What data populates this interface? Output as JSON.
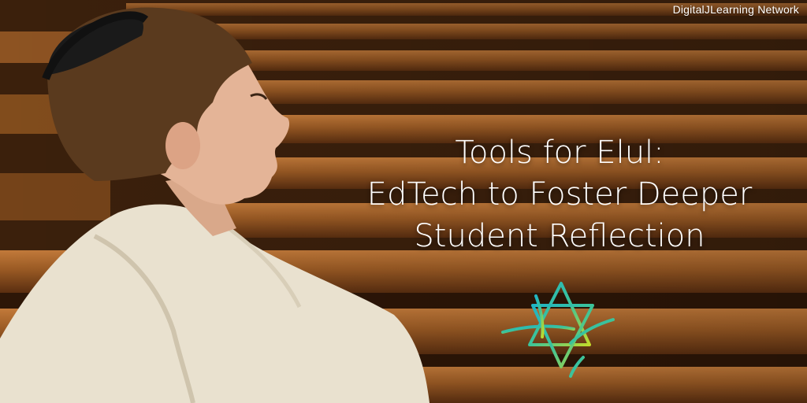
{
  "network_label": "DigitalJLearning Network",
  "headline": {
    "line1": "Tools for Elul:",
    "line2": "EdTech to Foster Deeper",
    "line3": "Student Reflection"
  },
  "colors": {
    "pew_wood": "#9a5a24",
    "kippah": "#1a1a1a",
    "tallit": "#e9e1cf",
    "logo_teal": "#22b3a8",
    "logo_green": "#b7d433"
  },
  "icons": [
    "star-of-david-logo-icon"
  ]
}
